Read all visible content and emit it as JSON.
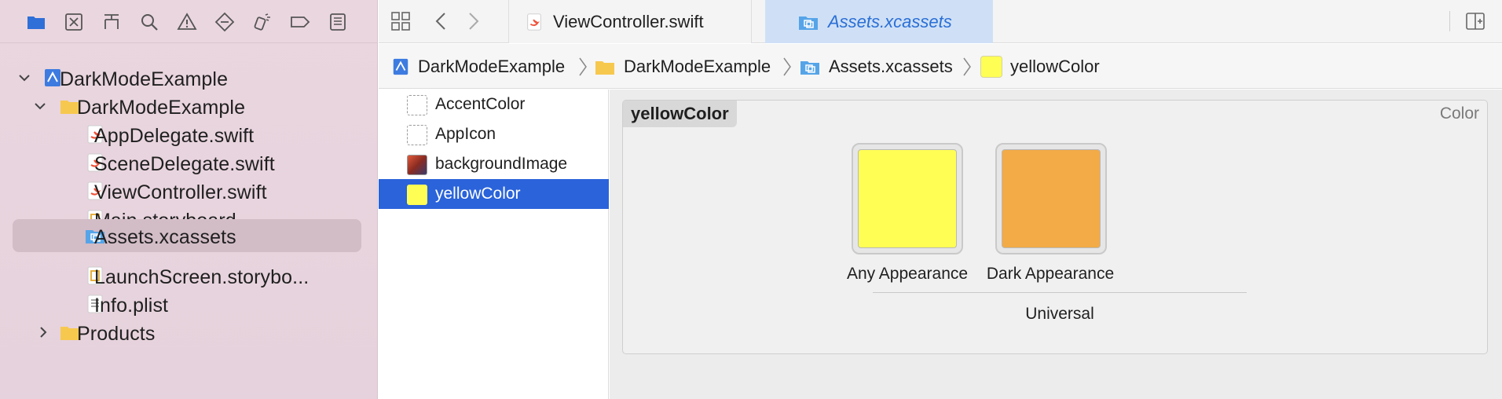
{
  "navigator": {
    "toolbar_icons": [
      "folder-icon",
      "source-control-icon",
      "hierarchy-icon",
      "search-icon",
      "warning-icon",
      "test-icon",
      "debug-icon",
      "breakpoint-icon",
      "report-icon"
    ],
    "tree": [
      {
        "label": "DarkModeExample",
        "icon": "project-icon",
        "level": 0,
        "disclosure": "expanded"
      },
      {
        "label": "DarkModeExample",
        "icon": "folder-icon",
        "level": 1,
        "disclosure": "expanded"
      },
      {
        "label": "AppDelegate.swift",
        "icon": "swift-file-icon",
        "level": 2
      },
      {
        "label": "SceneDelegate.swift",
        "icon": "swift-file-icon",
        "level": 2
      },
      {
        "label": "ViewController.swift",
        "icon": "swift-file-icon",
        "level": 2
      },
      {
        "label": "Main.storyboard",
        "icon": "storyboard-icon",
        "level": 2
      },
      {
        "label": "Assets.xcassets",
        "icon": "asset-catalog-icon",
        "level": 2,
        "selected": true
      },
      {
        "label": "LaunchScreen.storybo...",
        "icon": "storyboard-icon",
        "level": 2
      },
      {
        "label": "Info.plist",
        "icon": "plist-icon",
        "level": 2
      },
      {
        "label": "Products",
        "icon": "folder-icon",
        "level": 1,
        "disclosure": "collapsed"
      }
    ]
  },
  "editor": {
    "tabs": [
      {
        "label": "ViewController.swift",
        "icon": "swift-file-icon",
        "active": false
      },
      {
        "label": "Assets.xcassets",
        "icon": "asset-catalog-icon",
        "active": true
      }
    ],
    "breadcrumb": [
      {
        "label": "DarkModeExample",
        "icon": "project-icon"
      },
      {
        "label": "DarkModeExample",
        "icon": "folder-icon"
      },
      {
        "label": "Assets.xcassets",
        "icon": "asset-catalog-icon"
      },
      {
        "label": "yellowColor",
        "icon": "color-swatch-icon"
      }
    ]
  },
  "assets": [
    {
      "label": "AccentColor",
      "thumb": "empty"
    },
    {
      "label": "AppIcon",
      "thumb": "empty"
    },
    {
      "label": "backgroundImage",
      "thumb": "image"
    },
    {
      "label": "yellowColor",
      "thumb": "color",
      "selected": true
    }
  ],
  "color_set": {
    "name": "yellowColor",
    "type": "Color",
    "appearances": [
      {
        "label": "Any Appearance",
        "color": "#fffe55"
      },
      {
        "label": "Dark Appearance",
        "color": "#f2ab47"
      }
    ],
    "device_label": "Universal"
  },
  "colors": {
    "accent_blue": "#2a63da",
    "swift_orange": "#f05138",
    "folder_yellow": "#f7c84e"
  }
}
